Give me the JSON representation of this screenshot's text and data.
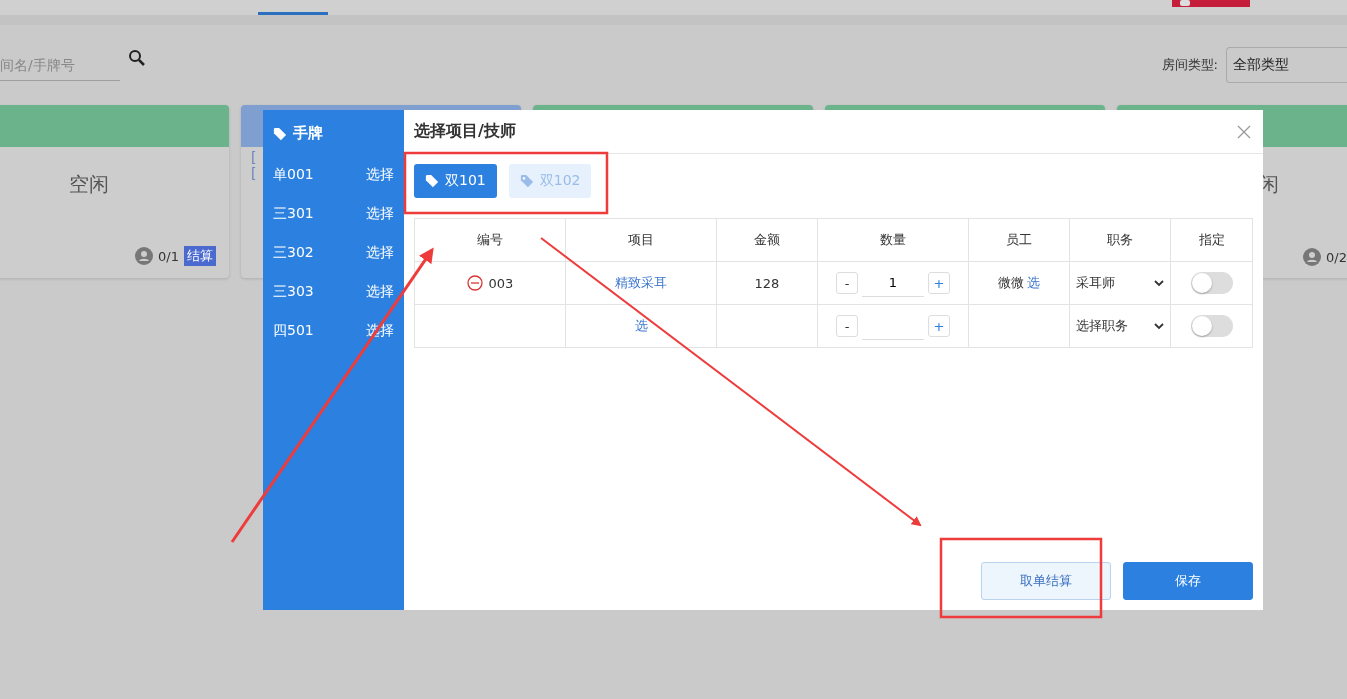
{
  "search": {
    "placeholder": "间名/手牌号"
  },
  "room_type_filter": {
    "label": "房间类型:",
    "value": "全部类型"
  },
  "rooms": [
    {
      "color": "#6bb38b",
      "status": "空闲",
      "occupancy": "0/1",
      "badge": "结算"
    },
    {
      "color": "#7f9fd1",
      "lines": [
        "[",
        "["
      ]
    },
    {
      "color": "#6bb38b"
    },
    {
      "color": "#6bb38b"
    },
    {
      "color": "#6bb38b",
      "status": "闲",
      "occupancy": "0/2"
    }
  ],
  "dialog": {
    "sidebar": {
      "title": "手牌",
      "items": [
        {
          "label": "单001",
          "action": "选择"
        },
        {
          "label": "三301",
          "action": "选择"
        },
        {
          "label": "三302",
          "action": "选择"
        },
        {
          "label": "三303",
          "action": "选择"
        },
        {
          "label": "四501",
          "action": "选择"
        }
      ]
    },
    "title": "选择项目/技师",
    "tags": [
      {
        "label": "双101",
        "selected": true
      },
      {
        "label": "双102",
        "selected": false
      }
    ],
    "table": {
      "columns": [
        "编号",
        "项目",
        "金额",
        "数量",
        "员工",
        "职务",
        "指定"
      ],
      "rows": [
        {
          "removable": true,
          "number": "003",
          "item": "精致采耳",
          "amount": "128",
          "decrement": "-",
          "quantity": "1",
          "increment": "+",
          "staff": "微微",
          "staff_action": "选",
          "role": "采耳师",
          "designated": false
        },
        {
          "removable": false,
          "item": "选",
          "decrement": "-",
          "increment": "+",
          "role": "选择职务",
          "designated": false
        }
      ]
    },
    "buttons": [
      {
        "label": "取单结算",
        "kind": "secondary"
      },
      {
        "label": "保存",
        "kind": "primary"
      }
    ]
  }
}
